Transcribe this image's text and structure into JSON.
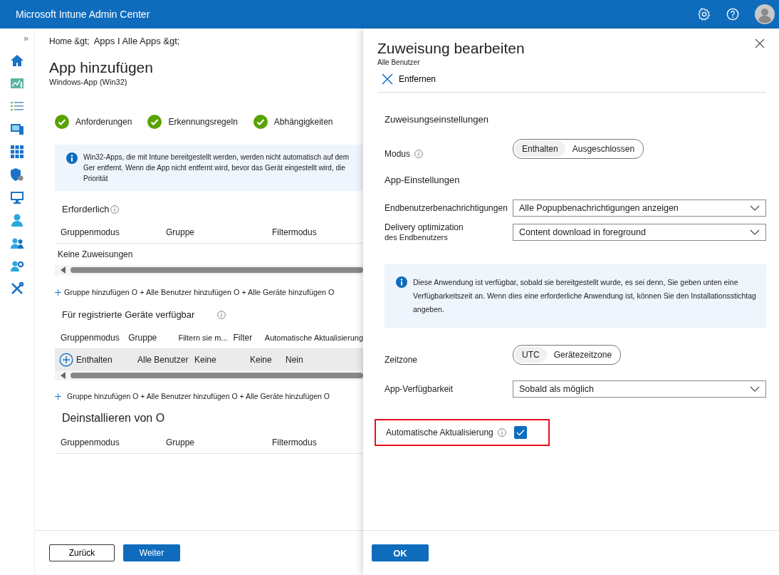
{
  "header": {
    "title": "Microsoft Intune Admin Center"
  },
  "sidebar": {
    "collapse": "»"
  },
  "breadcrumb": [
    "Home &gt;",
    "Apps I Alle Apps &gt;"
  ],
  "page": {
    "title": "App hinzufügen",
    "subtitle": "Windows-App (Win32)"
  },
  "steps": [
    {
      "label": "Anforderungen",
      "complete": true
    },
    {
      "label": "Erkennungsregeln",
      "complete": true
    },
    {
      "label": "Abhängigkeiten",
      "complete": true
    }
  ],
  "info": "Win32-Apps, die mit Intune bereitgestellt werden, werden nicht automatisch auf dem Ger entfernt. Wenn die App nicht entfernt wird, bevor das Gerät eingestellt wird, die Priorität",
  "sections": [
    {
      "title": "Erforderlich",
      "columns": [
        "Gruppenmodus",
        "Gruppe",
        "Filtermodus"
      ],
      "empty_text": "Keine Zuweisungen",
      "add_links": "Gruppe hinzufügen O + Alle Benutzer hinzufügen O + Alle Geräte hinzufügen O"
    },
    {
      "title": "Für registrierte Geräte verfügbar",
      "columns": [
        "Gruppenmodus",
        "Gruppe",
        "Filtern sie m...",
        "Filter",
        "Automatische Aktualisierung"
      ],
      "rows": [
        {
          "selected": true,
          "cells": [
            "Enthalten",
            "Alle Benutzer",
            "Keine",
            "Keine",
            "Nein"
          ]
        }
      ],
      "add_links": "Gruppe hinzufügen O + Alle Benutzer hinzufügen O + Alle Geräte hinzufügen O"
    },
    {
      "title": "Deinstallieren von O",
      "columns": [
        "Gruppenmodus",
        "Gruppe",
        "Filtermodus"
      ]
    }
  ],
  "footer": {
    "back": "Zurück",
    "next": "Weiter"
  },
  "flyout": {
    "title": "Zuweisung bearbeiten",
    "subtitle": "Alle Benutzer",
    "remove": "Entfernen",
    "rows": [
      {
        "kind": "heading",
        "text": "Zuweisungseinstellungen"
      },
      {
        "kind": "toggle",
        "label": "Modus",
        "info": true,
        "options": [
          {
            "label": "Enthalten",
            "selected": true
          },
          {
            "label": "Ausgeschlossen",
            "selected": false
          }
        ]
      },
      {
        "kind": "heading",
        "text": "App-Einstellungen"
      },
      {
        "kind": "dropdown",
        "label": "Endbenutzerbenachrichtigungen",
        "value": "Alle Popupbenachrichtigungen anzeigen"
      },
      {
        "kind": "dropdown",
        "label": "Delivery optimization",
        "label_extra": "des Endbenutzers",
        "value": "Content download in foreground"
      },
      {
        "kind": "notice",
        "text": "Diese Anwendung ist verfügbar, sobald sie bereitgestellt wurde, es sei denn, Sie geben unten eine Verfügbarkeitszeit an. Wenn dies eine erforderliche Anwendung ist, können Sie den Installationsstichtag angeben."
      },
      {
        "kind": "toggle",
        "label": "Zeitzone",
        "options": [
          {
            "label": "UTC",
            "selected": true
          },
          {
            "label": "Gerätezeitzone",
            "selected": false
          }
        ]
      },
      {
        "kind": "dropdown",
        "label": "App-Verfügbarkeit",
        "value": "Sobald als möglich"
      },
      {
        "kind": "checkbox",
        "label": "Automatische Aktualisierung",
        "info": true,
        "checked": true,
        "highlighted": true
      }
    ],
    "ok": "OK"
  }
}
